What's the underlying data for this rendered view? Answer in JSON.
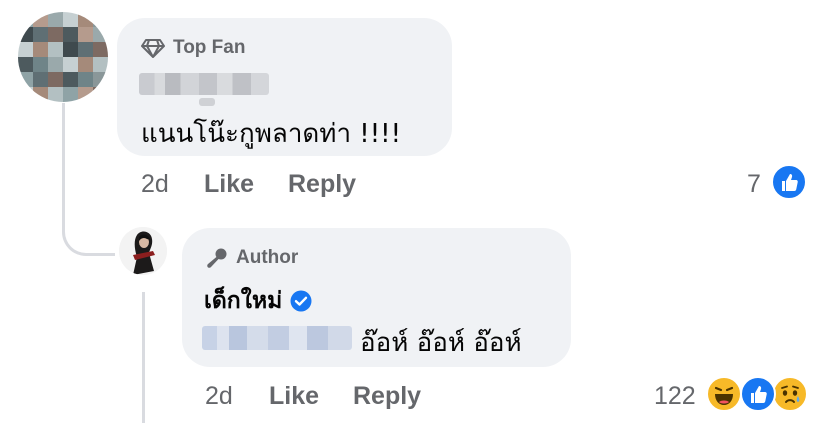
{
  "comment": {
    "badge_label": "Top Fan",
    "badge_icon": "diamond-icon",
    "text": "แนนโน๊ะกูพลาดท่า !!!!",
    "time": "2d",
    "like_label": "Like",
    "reply_label": "Reply",
    "reaction_count": "7",
    "reactions": [
      "like-icon"
    ]
  },
  "reply": {
    "badge_label": "Author",
    "badge_icon": "microphone-icon",
    "author_name": "เด็กใหม่",
    "verified_icon": "verified-badge-icon",
    "text": "อ๊อห์ อ๊อห์ อ๊อห์",
    "time": "2d",
    "like_label": "Like",
    "reply_label": "Reply",
    "reaction_count": "122",
    "reactions": [
      "haha-icon",
      "like-icon",
      "sad-icon"
    ]
  },
  "colors": {
    "bubble": "#f0f2f5",
    "secondary_text": "#65676b",
    "like_blue": "#1877f2",
    "verified_blue": "#1877f2",
    "thread_line": "#d9dbe0"
  }
}
